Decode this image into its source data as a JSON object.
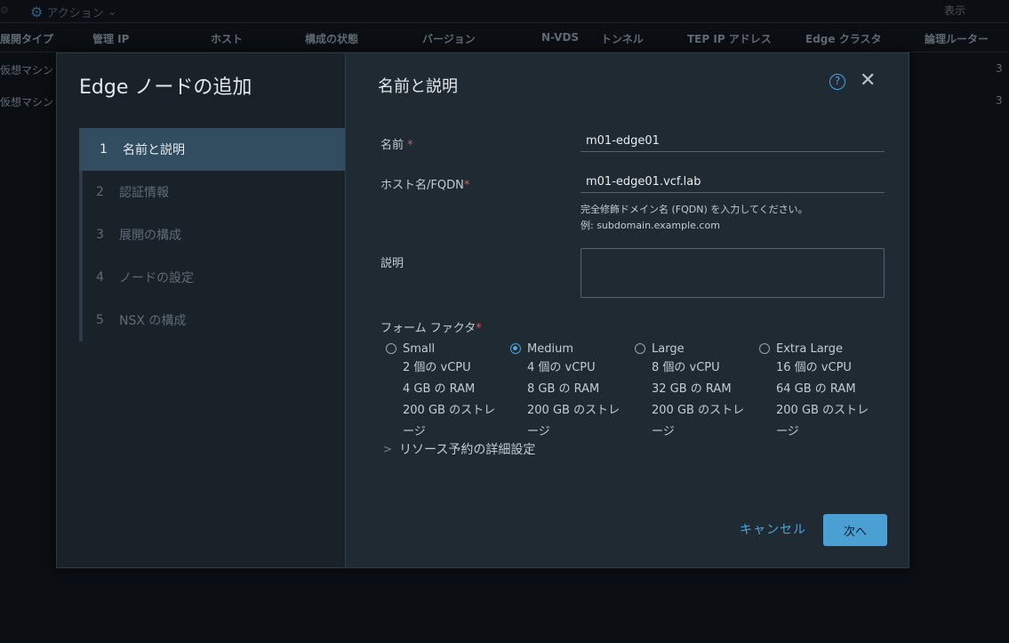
{
  "background": {
    "actions_label": "アクション",
    "view_label": "表示",
    "columns": [
      "展開タイプ",
      "管理 IP",
      "ホスト",
      "構成の状態",
      "バージョン",
      "N-VDS",
      "トンネル",
      "TEP IP アドレス",
      "Edge クラスタ",
      "論理ルーター"
    ],
    "rows": [
      {
        "type": "仮想マシン",
        "routers": "3"
      },
      {
        "type": "仮想マシン",
        "routers": "3"
      }
    ]
  },
  "wizard": {
    "title": "Edge ノードの追加",
    "steps": [
      {
        "num": "1",
        "label": "名前と説明"
      },
      {
        "num": "2",
        "label": "認証情報"
      },
      {
        "num": "3",
        "label": "展開の構成"
      },
      {
        "num": "4",
        "label": "ノードの設定"
      },
      {
        "num": "5",
        "label": "NSX の構成"
      }
    ],
    "active_step": 1
  },
  "content": {
    "title": "名前と説明",
    "help_icon": "?",
    "close_icon": "✕",
    "name": {
      "label": "名前",
      "value": "m01-edge01"
    },
    "hostname": {
      "label": "ホスト名/FQDN",
      "value": "m01-edge01.vcf.lab",
      "hint1": "完全修飾ドメイン名 (FQDN) を入力してください。",
      "hint2": "例: subdomain.example.com"
    },
    "description": {
      "label": "説明",
      "value": ""
    },
    "form_factor": {
      "label": "フォーム ファクタ",
      "selected": "Medium",
      "options": [
        {
          "name": "Small",
          "cpu": "2 個の vCPU",
          "ram": "4 GB の RAM",
          "storage1": "200 GB のストレ",
          "storage2": "ージ"
        },
        {
          "name": "Medium",
          "cpu": "4 個の vCPU",
          "ram": "8 GB の RAM",
          "storage1": "200 GB のストレ",
          "storage2": "ージ"
        },
        {
          "name": "Large",
          "cpu": "8 個の vCPU",
          "ram": "32 GB の RAM",
          "storage1": "200 GB のストレ",
          "storage2": "ージ"
        },
        {
          "name": "Extra Large",
          "cpu": "16 個の vCPU",
          "ram": "64 GB の RAM",
          "storage1": "200 GB のストレ",
          "storage2": "ージ"
        }
      ]
    },
    "advanced_label": "リソース予約の詳細設定",
    "cancel_label": "キャンセル",
    "next_label": "次へ"
  },
  "colors": {
    "accent": "#4aa7de",
    "required": "#e3545a",
    "modal_bg": "#1f2a33",
    "active_step_bg": "#324c60"
  }
}
